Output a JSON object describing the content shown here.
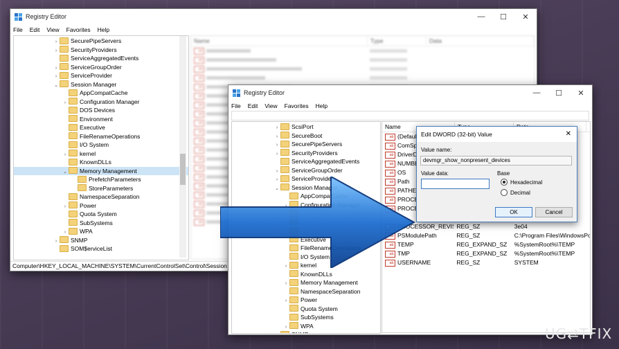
{
  "back_window": {
    "title": "Registry Editor",
    "controls": [
      "—",
      "☐",
      "✕"
    ],
    "menu": [
      "File",
      "Edit",
      "View",
      "Favorites",
      "Help"
    ],
    "tree": [
      {
        "label": "SecurePipeServers",
        "indent": 0,
        "expander": "›"
      },
      {
        "label": "SecurityProviders",
        "indent": 0,
        "expander": "›"
      },
      {
        "label": "ServiceAggregatedEvents",
        "indent": 0,
        "expander": ""
      },
      {
        "label": "ServiceGroupOrder",
        "indent": 0,
        "expander": "›"
      },
      {
        "label": "ServiceProvider",
        "indent": 0,
        "expander": "›"
      },
      {
        "label": "Session Manager",
        "indent": 0,
        "expander": "⌄"
      },
      {
        "label": "AppCompatCache",
        "indent": 1,
        "expander": ""
      },
      {
        "label": "Configuration Manager",
        "indent": 1,
        "expander": "›"
      },
      {
        "label": "DOS Devices",
        "indent": 1,
        "expander": ""
      },
      {
        "label": "Environment",
        "indent": 1,
        "expander": ""
      },
      {
        "label": "Executive",
        "indent": 1,
        "expander": ""
      },
      {
        "label": "FileRenameOperations",
        "indent": 1,
        "expander": ""
      },
      {
        "label": "I/O System",
        "indent": 1,
        "expander": ""
      },
      {
        "label": "kernel",
        "indent": 1,
        "expander": "›"
      },
      {
        "label": "KnownDLLs",
        "indent": 1,
        "expander": ""
      },
      {
        "label": "Memory Management",
        "indent": 1,
        "expander": "⌄",
        "selected": true
      },
      {
        "label": "PrefetchParameters",
        "indent": 2,
        "expander": ""
      },
      {
        "label": "StoreParameters",
        "indent": 2,
        "expander": ""
      },
      {
        "label": "NamespaceSeparation",
        "indent": 1,
        "expander": ""
      },
      {
        "label": "Power",
        "indent": 1,
        "expander": "›"
      },
      {
        "label": "Quota System",
        "indent": 1,
        "expander": ""
      },
      {
        "label": "SubSystems",
        "indent": 1,
        "expander": ""
      },
      {
        "label": "WPA",
        "indent": 1,
        "expander": "›"
      },
      {
        "label": "SNMP",
        "indent": 0,
        "expander": "›"
      },
      {
        "label": "SOM$erviceList",
        "indent": 0,
        "expander": ""
      }
    ],
    "list_header": [
      "Name",
      "Type",
      "Data"
    ],
    "status": "Computer\\HKEY_LOCAL_MACHINE\\SYSTEM\\CurrentControlSet\\Control\\Session Ma"
  },
  "front_window": {
    "title": "Registry Editor",
    "controls": [
      "—",
      "☐",
      "✕"
    ],
    "menu": [
      "File",
      "Edit",
      "View",
      "Favorites",
      "Help"
    ],
    "tree": [
      {
        "label": "ScsiPort",
        "indent": 0,
        "expander": "›"
      },
      {
        "label": "SecureBoot",
        "indent": 0,
        "expander": "›"
      },
      {
        "label": "SecurePipeServers",
        "indent": 0,
        "expander": "›"
      },
      {
        "label": "SecurityProviders",
        "indent": 0,
        "expander": "›"
      },
      {
        "label": "ServiceAggregatedEvents",
        "indent": 0,
        "expander": ""
      },
      {
        "label": "ServiceGroupOrder",
        "indent": 0,
        "expander": "›"
      },
      {
        "label": "ServiceProvider",
        "indent": 0,
        "expander": "›"
      },
      {
        "label": "Session Manager",
        "indent": 0,
        "expander": "⌄"
      },
      {
        "label": "AppCompatCache",
        "indent": 1,
        "expander": ""
      },
      {
        "label": "Configuration Manager",
        "indent": 1,
        "expander": "›"
      },
      {
        "label": "",
        "indent": 1,
        "expander": ""
      },
      {
        "label": "",
        "indent": 1,
        "expander": ""
      },
      {
        "label": "",
        "indent": 1,
        "expander": ""
      },
      {
        "label": "Executive",
        "indent": 1,
        "expander": ""
      },
      {
        "label": "FileRenameOperations",
        "indent": 1,
        "expander": ""
      },
      {
        "label": "I/O System",
        "indent": 1,
        "expander": ""
      },
      {
        "label": "kernel",
        "indent": 1,
        "expander": "›"
      },
      {
        "label": "KnownDLLs",
        "indent": 1,
        "expander": ""
      },
      {
        "label": "Memory Management",
        "indent": 1,
        "expander": "›"
      },
      {
        "label": "NamespaceSeparation",
        "indent": 1,
        "expander": ""
      },
      {
        "label": "Power",
        "indent": 1,
        "expander": "›"
      },
      {
        "label": "Quota System",
        "indent": 1,
        "expander": ""
      },
      {
        "label": "SubSystems",
        "indent": 1,
        "expander": ""
      },
      {
        "label": "WPA",
        "indent": 1,
        "expander": "›"
      },
      {
        "label": "SNMP",
        "indent": 0,
        "expander": "›"
      }
    ],
    "list_header": [
      "Name",
      "Type",
      "Data"
    ],
    "rows": [
      {
        "name": "(Default)",
        "type": "",
        "data": ""
      },
      {
        "name": "ComSpec",
        "type": "",
        "data": "32\\cr"
      },
      {
        "name": "DriverData",
        "type": "",
        "data": "\\Drive"
      },
      {
        "name": "NUMBER",
        "type": "",
        "data": ""
      },
      {
        "name": "OS",
        "type": "",
        "data": ""
      },
      {
        "name": "Path",
        "type": "",
        "data": "C:\\wi"
      },
      {
        "name": "PATHEXT",
        "type": "",
        "data": "VBS;.\\"
      },
      {
        "name": "PROCESS",
        "type": "",
        "data": ""
      },
      {
        "name": "PROCESS",
        "type": "",
        "data": "62 Ste"
      },
      {
        "name": "",
        "type": "",
        "data": ""
      },
      {
        "name": "PROCESSOR_REVISION",
        "type": "REG_SZ",
        "data": "3e04"
      },
      {
        "name": "PSModulePath",
        "type": "REG_SZ",
        "data": "C:\\Program Files\\WindowsPo"
      },
      {
        "name": "TEMP",
        "type": "REG_EXPAND_SZ",
        "data": "%SystemRoot%\\TEMP"
      },
      {
        "name": "TMP",
        "type": "REG_EXPAND_SZ",
        "data": "%SystemRoot%\\TEMP"
      },
      {
        "name": "USERNAME",
        "type": "REG_SZ",
        "data": "SYSTEM"
      }
    ]
  },
  "dialog": {
    "title": "Edit DWORD (32-bit) Value",
    "close": "✕",
    "value_name_label": "Value name:",
    "value_name": "devmgr_show_nonpresent_devices",
    "value_data_label": "Value data:",
    "value_data": "",
    "base_label": "Base",
    "base_options": [
      "Hexadecimal",
      "Decimal"
    ],
    "base_selected": "Hexadecimal",
    "ok_label": "OK",
    "cancel_label": "Cancel"
  },
  "watermark": "UG⇄TFIX",
  "arrow_color": "#1f6fd1"
}
